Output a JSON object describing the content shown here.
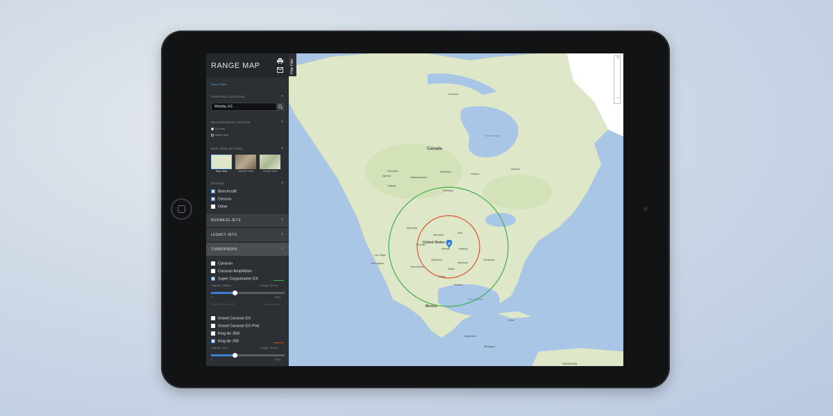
{
  "app": {
    "title": "RANGE MAP",
    "hide_filter_label": "Hide Filter",
    "reset_label": "Reset Filters"
  },
  "starting_location": {
    "label": "STARTING LOCATION",
    "value": "Wichita, KS"
  },
  "measurement": {
    "label": "MEASUREMENT SYSTEM",
    "options": [
      {
        "label": "US (nm)",
        "selected": true
      },
      {
        "label": "Metric (km)",
        "selected": false
      }
    ]
  },
  "map_view": {
    "label": "MAP VIEW OPTIONS",
    "options": [
      {
        "label": "Map View",
        "selected": true
      },
      {
        "label": "Satellite View",
        "selected": false
      },
      {
        "label": "Terrain View",
        "selected": false
      }
    ]
  },
  "brands": {
    "label": "BRANDS",
    "items": [
      {
        "label": "Beechcraft",
        "checked": true
      },
      {
        "label": "Cessna",
        "checked": true
      },
      {
        "label": "Other",
        "checked": false
      }
    ]
  },
  "categories": [
    {
      "label": "BUSINESS JETS",
      "expanded": false
    },
    {
      "label": "LEGACY JETS",
      "expanded": false
    },
    {
      "label": "TURBOPROPS",
      "expanded": true
    }
  ],
  "turboprops": {
    "items_a": [
      {
        "label": "Caravan",
        "checked": false
      },
      {
        "label": "Caravan Amphibian",
        "checked": false
      },
      {
        "label": "Super Cargomaster EX",
        "checked": true,
        "color": "#3fae49"
      }
    ],
    "slider1": {
      "payload": "Payload: 1000lbs",
      "range": "Range: 812nm",
      "min": "0",
      "max": "3000",
      "value_fraction": 0.32
    },
    "meta": {
      "left": "Explore this Aircraft",
      "right": "Assumptions"
    },
    "items_b": [
      {
        "label": "Grand Caravan EX",
        "checked": false
      },
      {
        "label": "Grand Caravan EX-Pod",
        "checked": false
      },
      {
        "label": "King Air 350i",
        "checked": false
      },
      {
        "label": "King Air 250",
        "checked": true,
        "color": "#d9532c"
      }
    ],
    "slider2": {
      "payload": "Payload: 1000",
      "range": "Range: 314nm",
      "min": "0",
      "max": "2000",
      "value_fraction": 0.32
    }
  },
  "map": {
    "labels": {
      "canada": "Canada",
      "united_states": "United States",
      "mexico": "Mexico",
      "hudson_bay": "Hudson Bay",
      "gulf": "Gulf of Mexico",
      "venezuela": "Venezuela",
      "oklahoma": "Oklahoma",
      "kansas": "Kansas",
      "nebraska": "Nebraska",
      "colorado": "Colorado",
      "missouri": "Missouri",
      "dallas": "Dallas",
      "texas": "Texas",
      "iowa": "Iowa",
      "wyoming": "Wyoming",
      "new_mexico": "New Mexico",
      "arkansas": "Arkansas",
      "tennessee": "Tennessee",
      "winnipeg": "Winnipeg",
      "edmonton": "Edmonton",
      "calgary": "Calgary",
      "las_vegas": "Las Vegas",
      "los_angeles": "Los Angeles",
      "houston": "Houston",
      "ontario": "Ontario",
      "quebec": "Quebec",
      "manitoba": "Manitoba",
      "saskatchewan": "Saskatchewan",
      "alberta": "Alberta",
      "nunavut": "Nunavut",
      "cuba": "Cuba",
      "guatemala": "Guatemala",
      "nicaragua": "Nicaragua"
    },
    "colors": {
      "water": "#a9c6e6",
      "land": "#dfe7c9",
      "ring_outer": "#3fae49",
      "ring_inner": "#d9532c"
    },
    "zoom_in": "+",
    "zoom_out": "−"
  }
}
